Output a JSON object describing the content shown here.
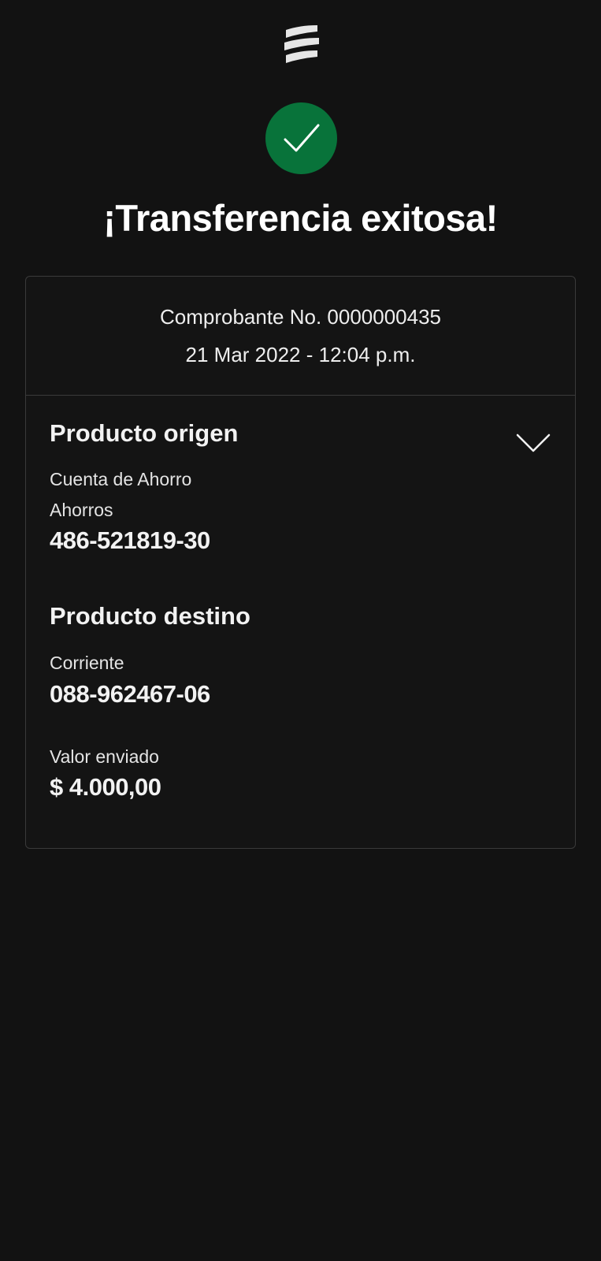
{
  "header": {
    "logo_icon": "bank-logo-icon",
    "status_icon": "success-check-icon",
    "status_color": "#08733a"
  },
  "title": "¡Transferencia exitosa!",
  "receipt": {
    "number_text": "Comprobante No. 0000000435",
    "datetime": "21 Mar 2022 - 12:04 p.m."
  },
  "origin": {
    "title": "Producto origen",
    "account_type": "Cuenta de Ahorro",
    "account_subtype": "Ahorros",
    "account_number": "486-521819-30",
    "toggle_icon": "chevron-down-icon"
  },
  "destination": {
    "title": "Producto destino",
    "account_type": "Corriente",
    "account_number": "088-962467-06"
  },
  "amount": {
    "label": "Valor enviado",
    "value": "$ 4.000,00"
  }
}
